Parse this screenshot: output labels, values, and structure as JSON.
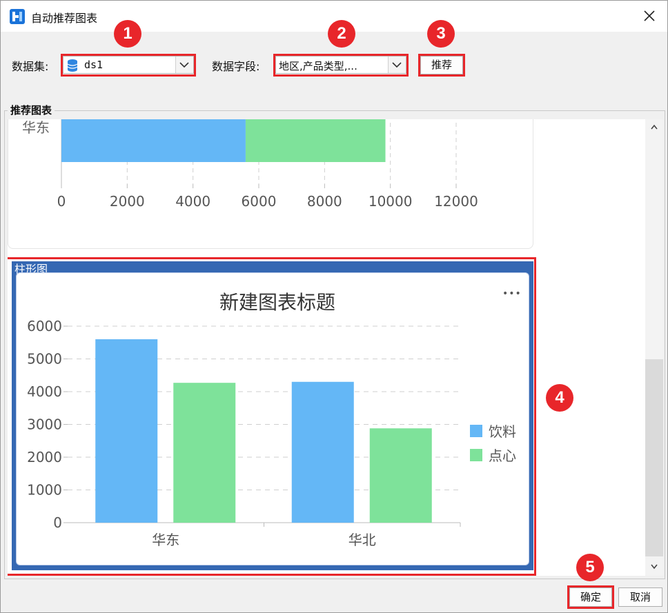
{
  "window": {
    "title": "自动推荐图表",
    "close_icon": "close-icon"
  },
  "toolbar": {
    "dataset_label": "数据集:",
    "dataset_value": "ds1",
    "field_label": "数据字段:",
    "field_value": "地区,产品类型,...",
    "recommend_label": "推荐"
  },
  "badges": [
    "1",
    "2",
    "3",
    "4",
    "5"
  ],
  "group": {
    "title": "推荐图表"
  },
  "charts": {
    "selected_label": "柱形图",
    "more_icon": "•••"
  },
  "chart_data": [
    {
      "type": "bar",
      "orientation": "horizontal",
      "stacked": true,
      "categories": [
        "华东"
      ],
      "series": [
        {
          "name": "饮料",
          "values": [
            5600
          ]
        },
        {
          "name": "点心",
          "values": [
            4250
          ]
        }
      ],
      "visible_legend": [
        "点心"
      ],
      "xticks": [
        "0",
        "2000",
        "4000",
        "6000",
        "8000",
        "10000",
        "12000"
      ],
      "xlim": [
        0,
        12000
      ],
      "grid": "vertical dashed",
      "colors": [
        "#64b7f6",
        "#7ee29a"
      ]
    },
    {
      "type": "bar",
      "title": "新建图表标题",
      "categories": [
        "华东",
        "华北"
      ],
      "series": [
        {
          "name": "饮料",
          "values": [
            5600,
            4300
          ]
        },
        {
          "name": "点心",
          "values": [
            4270,
            2880
          ]
        }
      ],
      "yticks": [
        "0",
        "1000",
        "2000",
        "3000",
        "4000",
        "5000",
        "6000"
      ],
      "ylim": [
        0,
        6000
      ],
      "grid": "horizontal dashed",
      "legend": "right",
      "colors": [
        "#64b7f6",
        "#7ee29a"
      ]
    }
  ],
  "footer": {
    "ok_label": "确定",
    "cancel_label": "取消"
  }
}
